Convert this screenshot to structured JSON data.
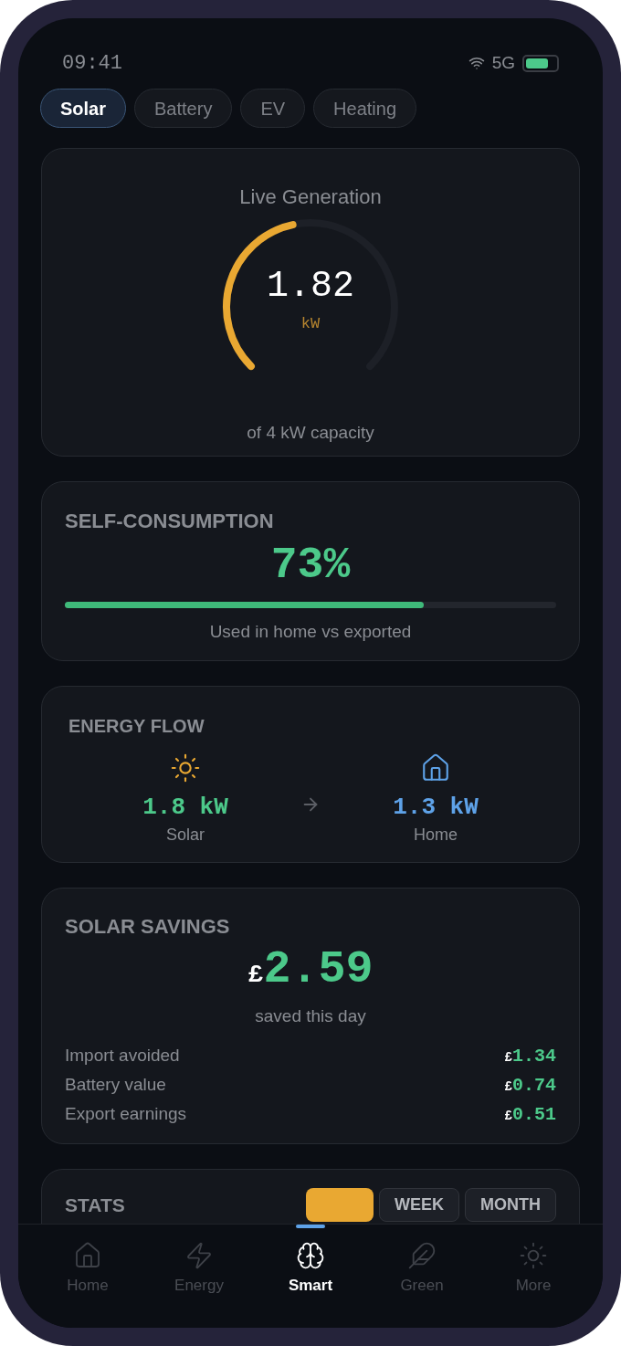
{
  "status_bar": {
    "time": "09:41",
    "network": "5G"
  },
  "tabs": [
    {
      "label": "Solar",
      "selected": true
    },
    {
      "label": "Battery",
      "selected": false
    },
    {
      "label": "EV",
      "selected": false
    },
    {
      "label": "Heating",
      "selected": false
    }
  ],
  "live_generation": {
    "title": "Live Generation",
    "value": "1.82",
    "unit": "kW",
    "caption": "of 4 kW capacity"
  },
  "self_consumption": {
    "title": "SELF-CONSUMPTION",
    "value": "73%",
    "level": 0.73,
    "caption": "Used in home vs exported"
  },
  "energy_flow": {
    "title": "ENERGY FLOW",
    "nodes": [
      {
        "kind": "solar",
        "value": "1.8 kW",
        "label": "Solar"
      },
      {
        "kind": "home",
        "value": "1.3 kW",
        "label": "Home"
      }
    ]
  },
  "solar_savings": {
    "title": "SOLAR SAVINGS",
    "currency": "£",
    "amount": "2.59",
    "caption": "saved this day",
    "items": [
      {
        "label": "Import avoided",
        "currency": "£",
        "amount": "1.34"
      },
      {
        "label": "Battery value",
        "currency": "£",
        "amount": "0.74"
      },
      {
        "label": "Export earnings",
        "currency": "£",
        "amount": "0.51"
      }
    ]
  },
  "stats": {
    "title": "STATS",
    "periods": [
      {
        "selected": true
      },
      {
        "label": "WEEK",
        "selected": false
      },
      {
        "label": "MONTH",
        "selected": false
      }
    ]
  },
  "bottom_nav": [
    {
      "kind": "home",
      "label": "Home",
      "selected": false
    },
    {
      "kind": "energy",
      "label": "Energy",
      "selected": false
    },
    {
      "kind": "smart",
      "label": "Smart",
      "selected": true
    },
    {
      "kind": "green",
      "label": "Green",
      "selected": false
    },
    {
      "kind": "more",
      "label": "More",
      "selected": false
    }
  ]
}
